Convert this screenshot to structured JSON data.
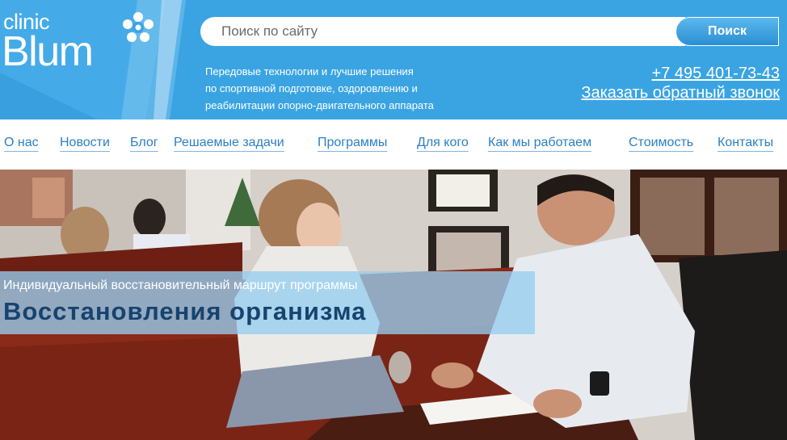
{
  "brand": {
    "clinic": "clinic",
    "name": "Blum"
  },
  "search": {
    "placeholder": "Поиск по сайту",
    "button_label": "Поиск"
  },
  "tagline": [
    "Передовые технологии и лучшие решения",
    "по спортивной подготовке, оздоровлению и",
    "реабилитации опорно-двигательного аппарата"
  ],
  "contact": {
    "phone": "+7 495 401-73-43",
    "callback": "Заказать обратный звонок"
  },
  "nav": {
    "items": [
      {
        "label": "О нас"
      },
      {
        "label": "Новости"
      },
      {
        "label": "Блог"
      },
      {
        "label": "Решаемые задачи"
      },
      {
        "label": "Программы"
      },
      {
        "label": "Для кого"
      },
      {
        "label": "Как мы работаем"
      },
      {
        "label": "Стоимость"
      },
      {
        "label": "Контакты"
      }
    ]
  },
  "hero": {
    "subtitle": "Индивидуальный восстановительный маршрут программы",
    "title": "Восстановления организма"
  },
  "colors": {
    "header_blue": "#3aa4e3",
    "nav_link": "#2b7fc5",
    "hero_title": "#17436e"
  }
}
